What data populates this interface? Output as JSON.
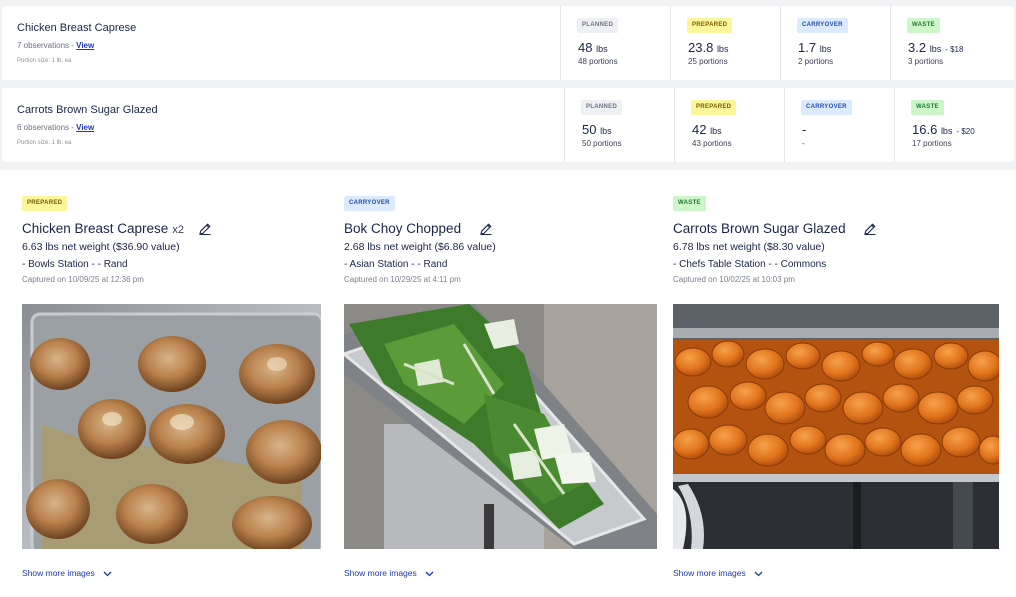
{
  "summary_cards": [
    {
      "title": "Chicken Breast Caprese",
      "observations": "7 observations - ",
      "view_label": "View",
      "portion_size": "Portion size: 1 lb. ea",
      "stats": {
        "planned": {
          "label": "PLANNED",
          "amount": "48",
          "unit": "lbs",
          "cost": "",
          "portions": "48 portions"
        },
        "prepared": {
          "label": "PREPARED",
          "amount": "23.8",
          "unit": "lbs",
          "cost": "",
          "portions": "25 portions"
        },
        "carryover": {
          "label": "CARRYOVER",
          "amount": "1.7",
          "unit": "lbs",
          "cost": "",
          "portions": "2 portions"
        },
        "waste": {
          "label": "WASTE",
          "amount": "3.2",
          "unit": "lbs",
          "cost": "- $18",
          "portions": "3 portions"
        }
      }
    },
    {
      "title": "Carrots Brown Sugar Glazed",
      "observations": "6 observations - ",
      "view_label": "View",
      "portion_size": "Portion size: 1 lb. ea",
      "stats": {
        "planned": {
          "label": "PLANNED",
          "amount": "50",
          "unit": "lbs",
          "cost": "",
          "portions": "50 portions"
        },
        "prepared": {
          "label": "PREPARED",
          "amount": "42",
          "unit": "lbs",
          "cost": "",
          "portions": "43 portions"
        },
        "carryover": {
          "label": "CARRYOVER",
          "amount": "-",
          "unit": "",
          "cost": "",
          "portions": "-"
        },
        "waste": {
          "label": "WASTE",
          "amount": "16.6",
          "unit": "lbs",
          "cost": "- $20",
          "portions": "17 portions"
        }
      }
    }
  ],
  "observation_cards": [
    {
      "badge": "PREPARED",
      "item": "Chicken Breast Caprese",
      "multiplier": "x2",
      "weight": "6.63 lbs net weight ($36.90 value)",
      "station": "- Bowls Station - - Rand",
      "captured": "Captured on 10/09/25 at 12:36 pm",
      "photo": "photo-chicken-breast-caprese",
      "show_more": "Show more images"
    },
    {
      "badge": "CARRYOVER",
      "item": "Bok Choy Chopped",
      "multiplier": "",
      "weight": "2.68 lbs net weight ($6.86 value)",
      "station": "- Asian Station - - Rand",
      "captured": "Captured on 10/29/25 at 4:11 pm",
      "photo": "photo-bok-choy-chopped",
      "show_more": "Show more images"
    },
    {
      "badge": "WASTE",
      "item": "Carrots Brown Sugar Glazed",
      "multiplier": "",
      "weight": "6.78 lbs net weight ($8.30 value)",
      "station": "- Chefs Table Station - - Commons",
      "captured": "Captured on 10/02/25 at 10:03 pm",
      "photo": "photo-carrots-brown-sugar-glazed",
      "show_more": "Show more images"
    }
  ],
  "colors": {
    "planned": "#eef0f3",
    "prepared": "#fbf59b",
    "carryover": "#dbeafc",
    "waste": "#cdf6c9",
    "link": "#1f3aa8",
    "text": "#1b2547"
  }
}
